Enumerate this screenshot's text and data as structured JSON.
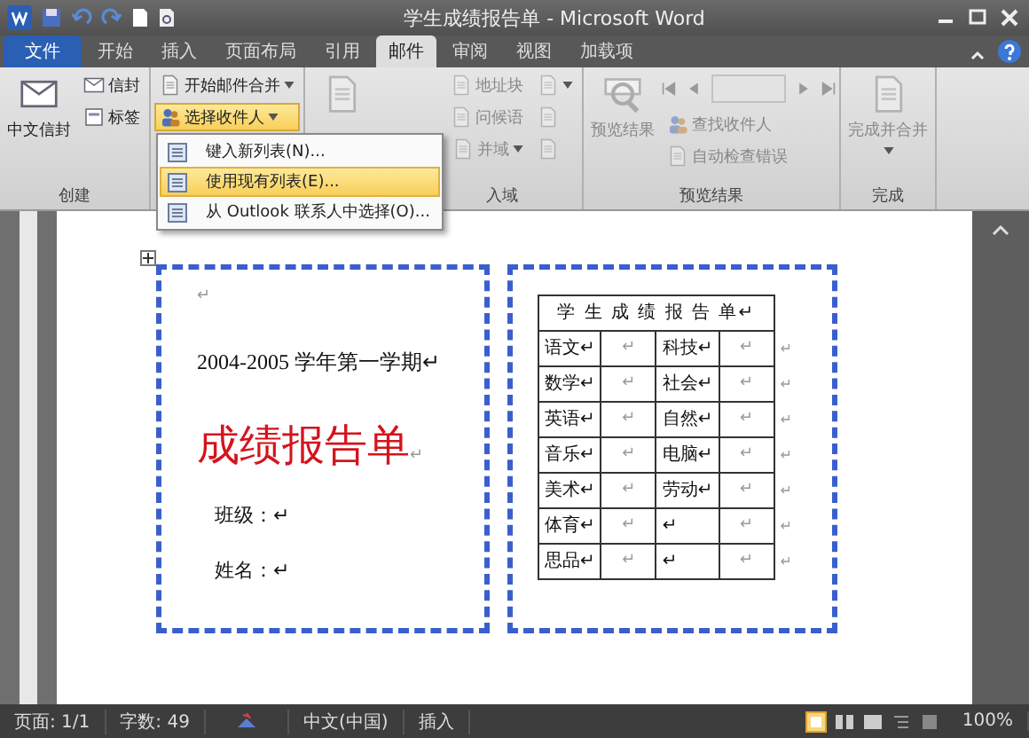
{
  "window": {
    "title": "学生成绩报告单 - Microsoft Word"
  },
  "tabs": [
    {
      "label": "文件",
      "kind": "file",
      "selected": false
    },
    {
      "label": "开始",
      "kind": "tab",
      "selected": false
    },
    {
      "label": "插入",
      "kind": "tab",
      "selected": false
    },
    {
      "label": "页面布局",
      "kind": "tab",
      "selected": false
    },
    {
      "label": "引用",
      "kind": "tab",
      "selected": false
    },
    {
      "label": "邮件",
      "kind": "tab",
      "selected": true
    },
    {
      "label": "审阅",
      "kind": "tab",
      "selected": false
    },
    {
      "label": "视图",
      "kind": "tab",
      "selected": false
    },
    {
      "label": "加载项",
      "kind": "tab",
      "selected": false
    }
  ],
  "ribbon": {
    "groups": [
      {
        "label": "创建",
        "columns": [
          [
            {
              "kind": "large",
              "label": "中文信封",
              "disabled": false,
              "highlighted": false,
              "dropdown": false
            }
          ],
          [
            {
              "kind": "small",
              "label": "信封",
              "disabled": false,
              "highlighted": false,
              "dropdown": false
            },
            {
              "kind": "small",
              "label": "标签",
              "disabled": false,
              "highlighted": false,
              "dropdown": false
            }
          ]
        ]
      },
      {
        "columns": [
          [
            {
              "kind": "small",
              "label": "开始邮件合并",
              "disabled": false,
              "highlighted": false,
              "dropdown": true
            },
            {
              "kind": "small",
              "label": "选择收件人",
              "disabled": false,
              "highlighted": true,
              "dropdown": true
            }
          ]
        ]
      },
      {
        "label": "入域",
        "columns": [
          [
            {
              "kind": "large",
              "disabled": true,
              "highlighted": false,
              "dropdown": false
            }
          ],
          [
            {
              "kind": "small",
              "label": "地址块",
              "disabled": true,
              "highlighted": false,
              "dropdown": false
            },
            {
              "kind": "small",
              "label": "问候语",
              "disabled": true,
              "highlighted": false,
              "dropdown": false
            },
            {
              "kind": "small",
              "label": "并域",
              "disabled": true,
              "highlighted": false,
              "dropdown": true
            }
          ],
          [
            {
              "kind": "small",
              "disabled": true,
              "highlighted": false,
              "dropdown": true
            },
            {
              "kind": "small",
              "disabled": true,
              "highlighted": false,
              "dropdown": false
            },
            {
              "kind": "small",
              "disabled": true,
              "highlighted": false,
              "dropdown": false
            }
          ]
        ]
      },
      {
        "label": "预览结果",
        "columns": [
          [
            {
              "kind": "large",
              "label": "预览结果",
              "disabled": true,
              "highlighted": false,
              "dropdown": false
            }
          ],
          [
            {
              "kind": "nav",
              "disabled": true
            },
            {
              "kind": "small",
              "label": "查找收件人",
              "disabled": true,
              "highlighted": false,
              "dropdown": false
            },
            {
              "kind": "small",
              "label": "自动检查错误",
              "disabled": true,
              "highlighted": false,
              "dropdown": false
            }
          ]
        ]
      },
      {
        "label": "完成",
        "columns": [
          [
            {
              "kind": "large",
              "label": "完成并合并",
              "disabled": true,
              "highlighted": false,
              "dropdown": true
            }
          ]
        ]
      }
    ]
  },
  "menu": {
    "items": [
      {
        "label": "键入新列表(N)...",
        "highlighted": false
      },
      {
        "label": "使用现有列表(E)...",
        "highlighted": true
      },
      {
        "label": "从 Outlook 联系人中选择(O)...",
        "highlighted": false
      }
    ]
  },
  "document": {
    "term": "2004-2005 学年第一学期↵",
    "title": "成绩报告单",
    "title_mark": "↵",
    "fields": [
      "班级：↵",
      "姓名：↵"
    ],
    "cell_mark": "↵",
    "report": {
      "heading": "学 生 成 绩 报 告 单↵",
      "row_end_mark": "↵",
      "rows": [
        [
          "语文↵",
          "↵",
          "科技↵",
          "↵"
        ],
        [
          "数学↵",
          "↵",
          "社会↵",
          "↵"
        ],
        [
          "英语↵",
          "↵",
          "自然↵",
          "↵"
        ],
        [
          "音乐↵",
          "↵",
          "电脑↵",
          "↵"
        ],
        [
          "美术↵",
          "↵",
          "劳动↵",
          "↵"
        ],
        [
          "体育↵",
          "↵",
          "↵",
          "↵"
        ],
        [
          "思品↵",
          "↵",
          "↵",
          "↵"
        ]
      ]
    }
  },
  "status_bar": {
    "items": [
      "页面: 1/1",
      "字数: 49"
    ],
    "language": "中文(中国)",
    "mode": "插入",
    "zoom": "100%"
  }
}
